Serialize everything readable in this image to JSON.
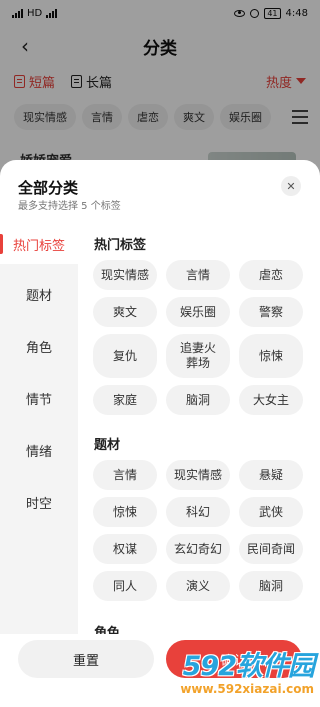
{
  "status_bar": {
    "left_carrier": "HD",
    "time": "4:48",
    "battery": "41"
  },
  "header": {
    "back_glyph": "‹",
    "title": "分类"
  },
  "type_tabs": [
    {
      "label": "短篇",
      "active": true
    },
    {
      "label": "长篇",
      "active": false
    }
  ],
  "sort": {
    "label": "热度"
  },
  "top_chips": [
    "现实情感",
    "言情",
    "虐恋",
    "爽文",
    "娱乐圈"
  ],
  "behind_list": {
    "first_title": "娇娇宠爱"
  },
  "sheet": {
    "title": "全部分类",
    "subtitle": "最多支持选择 5 个标签",
    "close_glyph": "✕",
    "nav": [
      "热门标签",
      "题材",
      "角色",
      "情节",
      "情绪",
      "时空"
    ],
    "active_nav": "热门标签",
    "sections": [
      {
        "title": "热门标签",
        "tags": [
          "现实情感",
          "言情",
          "虐恋",
          "爽文",
          "娱乐圈",
          "警察",
          "复仇",
          "追妻火葬场",
          "惊悚",
          "家庭",
          "脑洞",
          "大女主"
        ]
      },
      {
        "title": "题材",
        "tags": [
          "言情",
          "现实情感",
          "悬疑",
          "惊悚",
          "科幻",
          "武侠",
          "权谋",
          "玄幻奇幻",
          "民间奇闻",
          "同人",
          "演义",
          "脑洞"
        ]
      },
      {
        "title": "角色",
        "tags": []
      }
    ],
    "reset_label": "重置",
    "confirm_label": "确认"
  },
  "watermark": {
    "logo": "592软件园",
    "url": "www.592xiazai.com"
  },
  "colors": {
    "accent": "#e8413b",
    "chip_bg": "#f2f2f2",
    "watermark_blue": "#27a4dd",
    "watermark_orange": "#f2a22a"
  }
}
